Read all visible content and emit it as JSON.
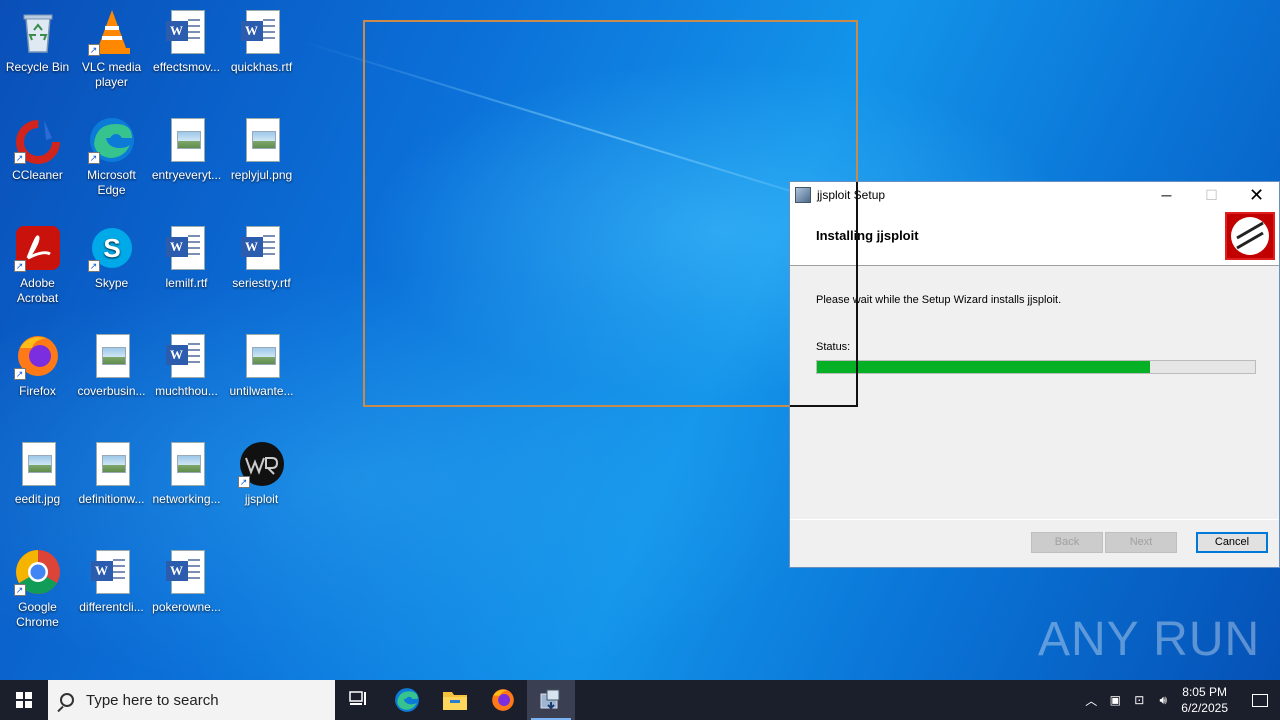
{
  "desktop": {
    "icons": [
      {
        "label": "Recycle Bin",
        "icon": "recycle-bin-icon"
      },
      {
        "label": "VLC media player",
        "icon": "vlc-icon"
      },
      {
        "label": "effectsmov...",
        "icon": "word-doc-icon"
      },
      {
        "label": "quickhas.rtf",
        "icon": "word-doc-icon"
      },
      {
        "label": "CCleaner",
        "icon": "ccleaner-icon"
      },
      {
        "label": "Microsoft Edge",
        "icon": "edge-icon"
      },
      {
        "label": "entryeveryt...",
        "icon": "image-file-icon"
      },
      {
        "label": "replyjul.png",
        "icon": "image-file-icon"
      },
      {
        "label": "Adobe Acrobat",
        "icon": "acrobat-icon"
      },
      {
        "label": "Skype",
        "icon": "skype-icon"
      },
      {
        "label": "lemilf.rtf",
        "icon": "word-doc-icon"
      },
      {
        "label": "seriestry.rtf",
        "icon": "word-doc-icon"
      },
      {
        "label": "Firefox",
        "icon": "firefox-icon"
      },
      {
        "label": "coverbusin...",
        "icon": "image-file-icon"
      },
      {
        "label": "muchthou...",
        "icon": "word-doc-icon"
      },
      {
        "label": "untilwante...",
        "icon": "image-file-icon"
      },
      {
        "label": "eedit.jpg",
        "icon": "image-file-icon"
      },
      {
        "label": "definitionw...",
        "icon": "image-file-icon"
      },
      {
        "label": "networking...",
        "icon": "image-file-icon"
      },
      {
        "label": "jjsploit",
        "icon": "jjsploit-icon"
      },
      {
        "label": "Google Chrome",
        "icon": "chrome-icon"
      },
      {
        "label": "differentcli...",
        "icon": "word-doc-icon"
      },
      {
        "label": "pokerowne...",
        "icon": "word-doc-icon"
      }
    ]
  },
  "setup_window": {
    "title": "jjsploit Setup",
    "heading": "Installing jjsploit",
    "body_text": "Please wait while the Setup Wizard installs jjsploit.",
    "status_label": "Status:",
    "progress": 0.76,
    "buttons": {
      "back": "Back",
      "next": "Next",
      "cancel": "Cancel"
    }
  },
  "watermark": "ANY RUN",
  "taskbar": {
    "search_placeholder": "Type here to search",
    "time": "8:05 PM",
    "date": "6/2/2025"
  },
  "colors": {
    "progress_fill": "#06b025",
    "accent": "#0078d7"
  }
}
